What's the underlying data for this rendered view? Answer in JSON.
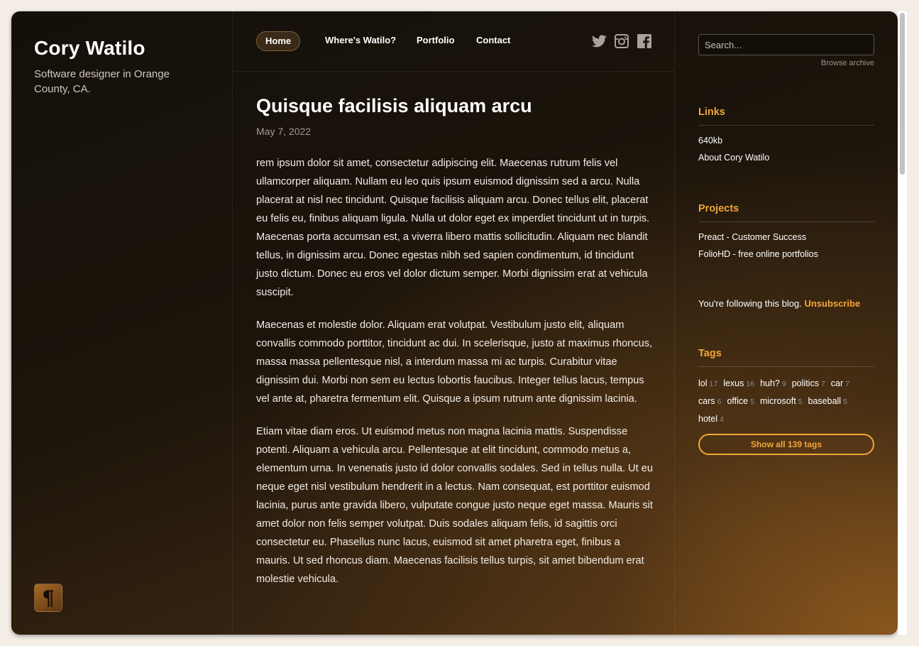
{
  "site": {
    "title": "Cory Watilo",
    "tagline": "Software designer in Orange County, CA.",
    "logo_glyph": "¶"
  },
  "nav": {
    "items": [
      {
        "label": "Home",
        "active": true
      },
      {
        "label": "Where's Watilo?"
      },
      {
        "label": "Portfolio"
      },
      {
        "label": "Contact"
      }
    ],
    "social_icons": [
      "twitter-icon",
      "instagram-icon",
      "facebook-icon"
    ]
  },
  "post": {
    "title": "Quisque facilisis aliquam arcu",
    "date": "May 7, 2022",
    "paragraphs": [
      "rem ipsum dolor sit amet, consectetur adipiscing elit. Maecenas rutrum felis vel ullamcorper aliquam. Nullam eu leo quis ipsum euismod dignissim sed a arcu. Nulla placerat at nisl nec tincidunt. Quisque facilisis aliquam arcu. Donec tellus elit, placerat eu felis eu, finibus aliquam ligula. Nulla ut dolor eget ex imperdiet tincidunt ut in turpis. Maecenas porta accumsan est, a viverra libero mattis sollicitudin. Aliquam nec blandit tellus, in dignissim arcu. Donec egestas nibh sed sapien condimentum, id tincidunt justo dictum. Donec eu eros vel dolor dictum semper. Morbi dignissim erat at vehicula suscipit.",
      "Maecenas et molestie dolor. Aliquam erat volutpat. Vestibulum justo elit, aliquam convallis commodo porttitor, tincidunt ac dui. In scelerisque, justo at maximus rhoncus, massa massa pellentesque nisl, a interdum massa mi ac turpis. Curabitur vitae dignissim dui. Morbi non sem eu lectus lobortis faucibus. Integer tellus lacus, tempus vel ante at, pharetra fermentum elit. Quisque a ipsum rutrum ante dignissim lacinia.",
      "Etiam vitae diam eros. Ut euismod metus non magna lacinia mattis. Suspendisse potenti. Aliquam a vehicula arcu. Pellentesque at elit tincidunt, commodo metus a, elementum urna. In venenatis justo id dolor convallis sodales. Sed in tellus nulla. Ut eu neque eget nisl vestibulum hendrerit in a lectus. Nam consequat, est porttitor euismod lacinia, purus ante gravida libero, vulputate congue justo neque eget massa. Mauris sit amet dolor non felis semper volutpat. Duis sodales aliquam felis, id sagittis orci consectetur eu. Phasellus nunc lacus, euismod sit amet pharetra eget, finibus a mauris. Ut sed rhoncus diam. Maecenas facilisis tellus turpis, sit amet bibendum erat molestie vehicula."
    ]
  },
  "sidebar": {
    "search_placeholder": "Search...",
    "browse_archive": "Browse archive",
    "links": {
      "heading": "Links",
      "items": [
        "640kb",
        "About Cory Watilo"
      ]
    },
    "projects": {
      "heading": "Projects",
      "items": [
        "Preact - Customer Success",
        "FolioHD - free online portfolios"
      ]
    },
    "follow": {
      "text": "You're following this blog.",
      "action": "Unsubscribe"
    },
    "tags": {
      "heading": "Tags",
      "items": [
        {
          "name": "lol",
          "count": "17"
        },
        {
          "name": "lexus",
          "count": "16"
        },
        {
          "name": "huh?",
          "count": "9"
        },
        {
          "name": "politics",
          "count": "7"
        },
        {
          "name": "car",
          "count": "7"
        },
        {
          "name": "cars",
          "count": "6"
        },
        {
          "name": "office",
          "count": "5"
        },
        {
          "name": "microsoft",
          "count": "5"
        },
        {
          "name": "baseball",
          "count": "5"
        },
        {
          "name": "hotel",
          "count": "4"
        }
      ],
      "show_all": "Show all 139 tags"
    }
  },
  "colors": {
    "accent": "#f0a63a",
    "page_bg": "#f3ede6",
    "panel_dark": "#141009"
  }
}
